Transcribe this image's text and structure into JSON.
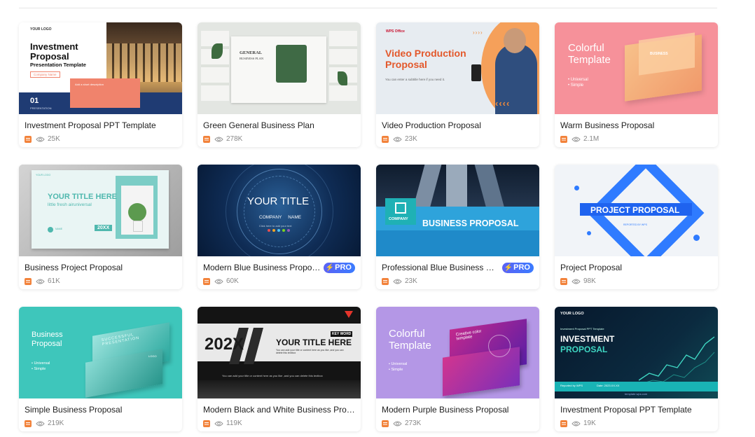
{
  "cards": [
    {
      "title": "Investment Proposal PPT Template",
      "views": "25K",
      "thumb": {
        "logo": "YOUR LOGO",
        "line1": "Investment",
        "line2": "Proposal",
        "line3": "Presentation Template",
        "name": "Company Name",
        "num": "01",
        "numlabel": "PRESENTATION",
        "box": "Add a short description"
      }
    },
    {
      "title": "Green General Business Plan",
      "views": "278K",
      "thumb": {
        "line1": "GENERAL",
        "line2": "BUSINESS PLAN"
      }
    },
    {
      "title": "Video Production Proposal",
      "views": "23K",
      "thumb": {
        "brand": "WPS Office",
        "line1": "Video Production",
        "line2": "Proposal",
        "sub": "You can enter a subtitle here if you need it.",
        "arrows": "››››",
        "arrows2": "‹‹‹‹"
      }
    },
    {
      "title": "Warm Business Proposal",
      "views": "2.1M",
      "thumb": {
        "line1": "Colorful",
        "line2": "Template",
        "b1": "• Universal",
        "b2": "• Simple",
        "tag": "BUSINESS"
      }
    },
    {
      "title": "Business Project Proposal",
      "views": "61K",
      "thumb": {
        "line1": "YOUR TITLE HERE",
        "line2": "little fresh airuniversal",
        "year": "20XX",
        "logo": "YOUR LOGO",
        "name": "NAME"
      }
    },
    {
      "title": "Modern Blue Business Proposal...",
      "views": "60K",
      "pro": "PRO",
      "thumb": {
        "line1": "YOUR TITLE",
        "line2": "COMPANY     NAME",
        "sub": "Click here to add your text"
      }
    },
    {
      "title": "Professional Blue Business Prop...",
      "views": "23K",
      "pro": "PRO",
      "thumb": {
        "company": "COMPANY",
        "line1": "BUSINESS PROPOSAL"
      }
    },
    {
      "title": "Project Proposal",
      "views": "98K",
      "thumb": {
        "line1": "PROJECT PROPOSAL",
        "sub": "REPORTED BY WPS"
      }
    },
    {
      "title": "Simple Business Proposal",
      "views": "219K",
      "thumb": {
        "line1": "Business",
        "line2": "Proposal",
        "b1": "• Universal",
        "b2": "• Simple",
        "slide": "SUCCESSFUL PRESENTATION",
        "logo": "LOGO"
      }
    },
    {
      "title": "Modern Black and White Business Prop...",
      "views": "119K",
      "thumb": {
        "year": "202X",
        "key": "KEY WORD",
        "line1": "YOUR TITLE HERE",
        "sub": "You can add your title or content here as you like ,and you can delete this textbox",
        "sub2": "You can add your title or content here as you like ,and you can delete this textbox"
      }
    },
    {
      "title": "Modern Purple Business Proposal",
      "views": "273K",
      "thumb": {
        "line1": "Colorful",
        "line2": "Template",
        "b1": "• Universal",
        "b2": "• Simple",
        "slide": "Creative color template"
      }
    },
    {
      "title": "Investment Proposal PPT Template",
      "views": "19K",
      "thumb": {
        "logo": "YOUR LOGO",
        "small": "Investment Proposal PPT Template",
        "line1": "INVESTMENT",
        "line2": "PROPOSAL",
        "by": "Reported by WPS",
        "date": "Date: 2023.XX.XX",
        "url": "template.wps.com"
      }
    }
  ]
}
